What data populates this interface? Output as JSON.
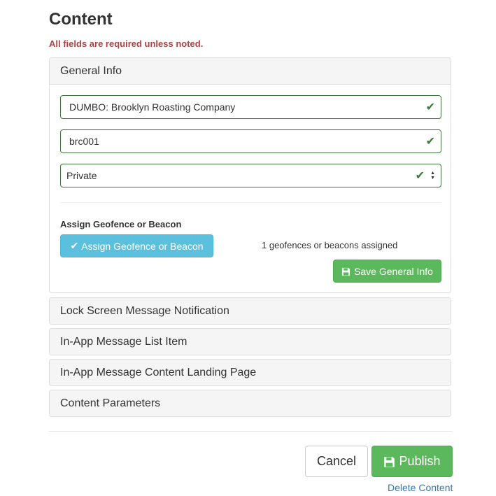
{
  "header": {
    "title": "Content",
    "required_note": "All fields are required unless noted."
  },
  "general_info": {
    "heading": "General Info",
    "name_value": "DUMBO: Brooklyn Roasting Company",
    "code_value": "brc001",
    "visibility_value": "Private",
    "assign_section_label": "Assign Geofence or Beacon",
    "assign_button_label": "Assign Geofence or Beacon",
    "assigned_count_text": "1 geofences or beacons assigned",
    "save_button_label": "Save General Info"
  },
  "sections": [
    {
      "heading": "Lock Screen Message Notification"
    },
    {
      "heading": "In-App Message List Item"
    },
    {
      "heading": "In-App Message Content Landing Page"
    },
    {
      "heading": "Content Parameters"
    }
  ],
  "footer": {
    "cancel_label": "Cancel",
    "publish_label": "Publish",
    "delete_label": "Delete Content"
  },
  "icons": {
    "valid": "checkmark-icon",
    "save": "floppy-disk-icon",
    "assign": "checkmark-icon",
    "select": "select-arrows-icon"
  },
  "colors": {
    "success": "#3c763d",
    "danger_text": "#a94442",
    "info_button": "#5bc0de",
    "success_button": "#5cb85c",
    "link": "#337ab7"
  }
}
